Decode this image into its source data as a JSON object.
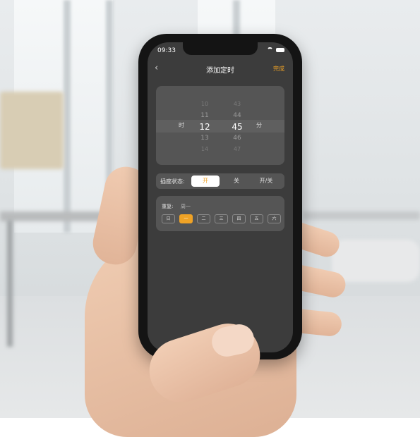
{
  "status_bar": {
    "time": "09:33"
  },
  "navbar": {
    "back_icon": "chevron-left-icon",
    "title": "添加定时",
    "done_label": "完成"
  },
  "time_picker": {
    "hour_label": "时",
    "minute_label": "分",
    "hours": [
      "10",
      "11",
      "12",
      "13",
      "14"
    ],
    "minutes": [
      "43",
      "44",
      "45",
      "46",
      "47"
    ],
    "selected_hour": "12",
    "selected_minute": "45"
  },
  "socket_state": {
    "label": "插座状态:",
    "options": [
      "开",
      "关",
      "开/关"
    ],
    "selected": "开"
  },
  "repeat": {
    "label": "重复:",
    "value": "周一",
    "days": [
      "日",
      "一",
      "二",
      "三",
      "四",
      "五",
      "六"
    ],
    "selected_day": "一"
  },
  "colors": {
    "accent": "#f0a326",
    "screen_bg": "#3c3c3c",
    "card_bg": "#555555"
  }
}
